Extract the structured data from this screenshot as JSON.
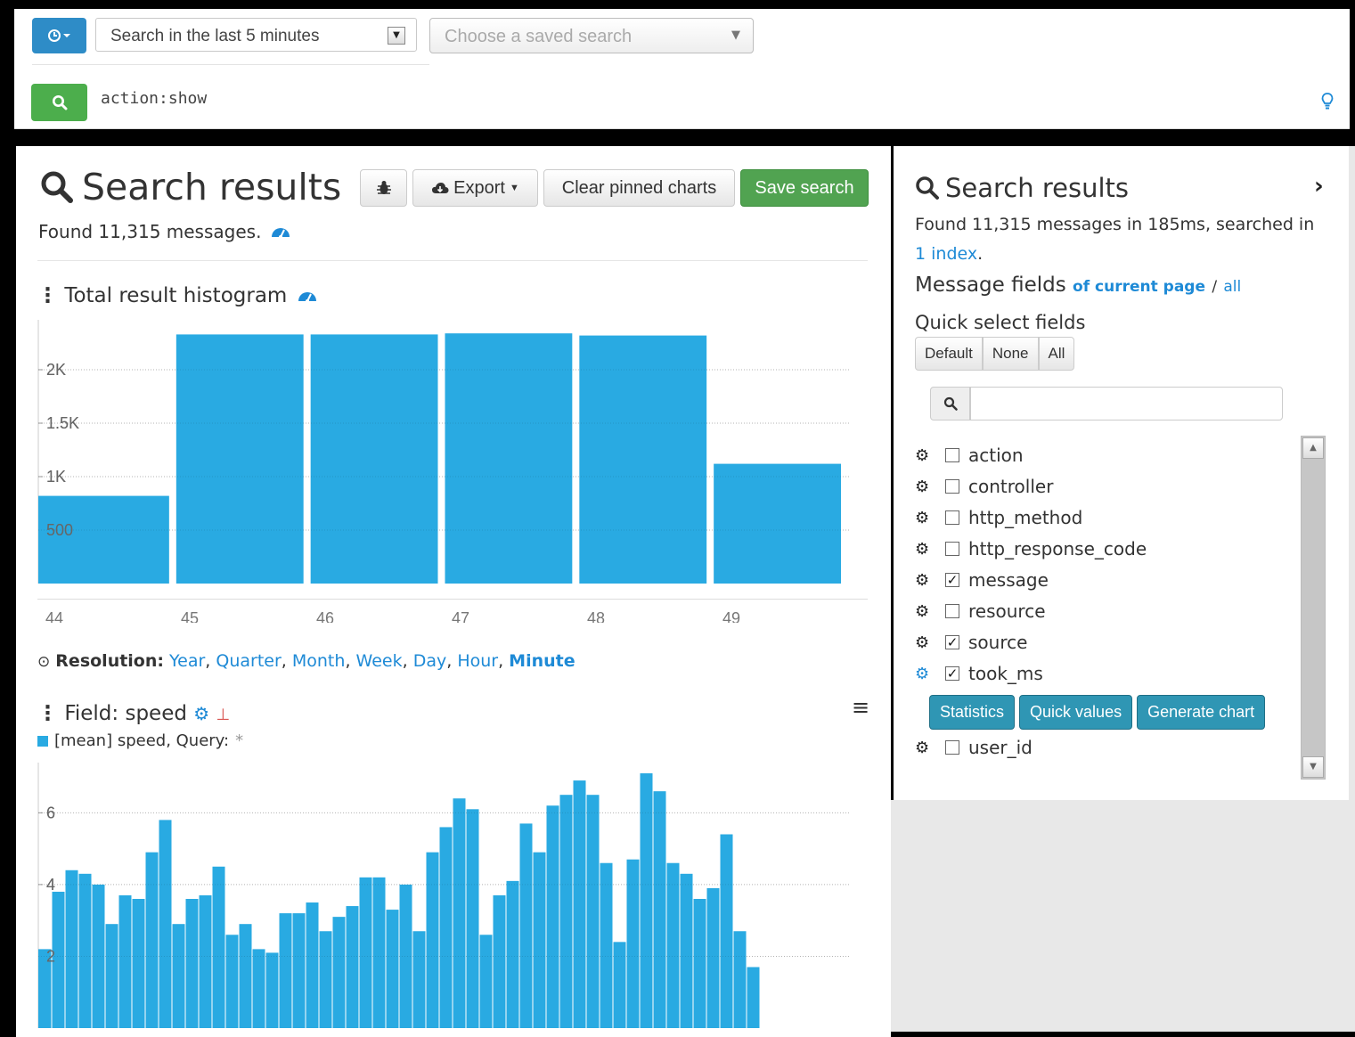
{
  "topbar": {
    "time_icon": "clock-icon",
    "range_text": "Search in the last 5 minutes",
    "saved_placeholder": "Choose a saved search",
    "query": "action:show"
  },
  "main": {
    "title": "Search results",
    "export_label": "Export",
    "clear_label": "Clear pinned charts",
    "save_label": "Save search",
    "found_text": "Found 11,315 messages.",
    "histogram_title": "Total result histogram",
    "resolution_label": "Resolution:",
    "resolutions": [
      "Year",
      "Quarter",
      "Month",
      "Week",
      "Day",
      "Hour",
      "Minute"
    ],
    "field_title": "Field: speed",
    "legend_text": "[mean] speed, Query:",
    "legend_query": "*"
  },
  "right": {
    "title": "Search results",
    "found_prefix": "Found 11,315 messages in 185ms, searched in",
    "found_link": "1 index",
    "found_suffix": ".",
    "msg_fields_label": "Message fields",
    "of_current_page": "of current page",
    "slash": "/",
    "all_link": "all",
    "quick_select_label": "Quick select fields",
    "quick_buttons": [
      "Default",
      "None",
      "All"
    ],
    "fields": [
      {
        "name": "action",
        "checked": false
      },
      {
        "name": "controller",
        "checked": false
      },
      {
        "name": "http_method",
        "checked": false
      },
      {
        "name": "http_response_code",
        "checked": false
      },
      {
        "name": "message",
        "checked": true
      },
      {
        "name": "resource",
        "checked": false
      },
      {
        "name": "source",
        "checked": true
      },
      {
        "name": "took_ms",
        "checked": true
      },
      {
        "name": "user_id",
        "checked": false
      }
    ],
    "field_actions": [
      "Statistics",
      "Quick values",
      "Generate chart"
    ]
  },
  "chart_data": [
    {
      "type": "bar",
      "title": "Total result histogram",
      "categories": [
        "44",
        "45",
        "46",
        "47",
        "48",
        "49"
      ],
      "values": [
        820,
        2330,
        2330,
        2340,
        2320,
        1120
      ],
      "y_ticks": [
        "500",
        "1K",
        "1.5K",
        "2K"
      ],
      "ylim": [
        0,
        2400
      ],
      "color": "#29aae2",
      "grid": true
    },
    {
      "type": "bar",
      "title": "Field: speed",
      "series": [
        {
          "name": "[mean] speed, Query: *",
          "values": [
            2.2,
            3.8,
            4.4,
            4.3,
            4.0,
            2.9,
            3.7,
            3.6,
            4.9,
            5.8,
            2.9,
            3.6,
            3.7,
            4.5,
            2.6,
            2.9,
            2.2,
            2.1,
            3.2,
            3.2,
            3.5,
            2.7,
            3.1,
            3.4,
            4.2,
            4.2,
            3.3,
            4.0,
            2.7,
            4.9,
            5.6,
            6.4,
            6.1,
            2.6,
            3.7,
            4.1,
            5.7,
            4.9,
            6.2,
            6.5,
            6.9,
            6.5,
            4.6,
            2.4,
            4.7,
            7.1,
            6.6,
            4.6,
            4.3,
            3.6,
            3.9,
            5.4,
            2.7,
            1.7
          ]
        }
      ],
      "y_ticks": [
        "2",
        "4",
        "6"
      ],
      "ylim": [
        0,
        7.2
      ],
      "color": "#29aae2",
      "grid": true
    }
  ]
}
